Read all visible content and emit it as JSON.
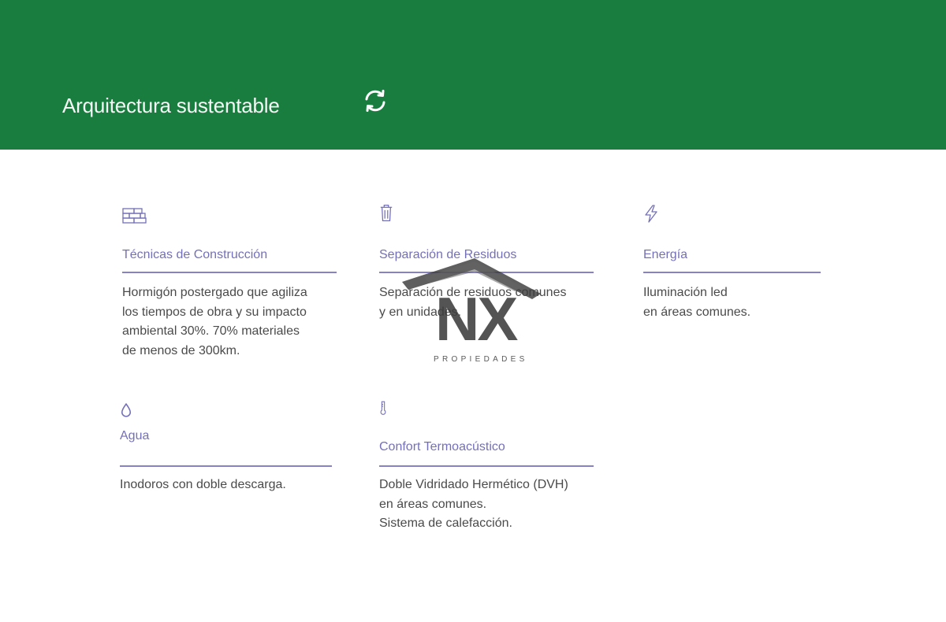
{
  "header": {
    "title": "Arquitectura sustentable",
    "background": "#1a7d40",
    "refresh_icon": "refresh-icon"
  },
  "accent_color": "#7470b8",
  "features": [
    {
      "icon": "bricks-icon",
      "title": "Técnicas de Construcción",
      "lines": [
        "Hormigón postergado que agiliza",
        "los tiempos de obra y su impacto",
        "ambiental 30%. 70% materiales",
        "de menos de 300km."
      ]
    },
    {
      "icon": "trash-icon",
      "title": "Separación de Residuos",
      "lines": [
        "Separación de residuos comunes",
        "y en unidades."
      ]
    },
    {
      "icon": "lightning-icon",
      "title": "Energía",
      "lines": [
        "Iluminación led",
        "en áreas comunes."
      ]
    },
    {
      "icon": "water-drop-icon",
      "title": "Agua",
      "lines": [
        "Inodoros con doble descarga."
      ]
    },
    {
      "icon": "thermometer-icon",
      "title": "Confort Termoacústico",
      "lines": [
        "Doble Vidridado Hermético (DVH)",
        "en áreas comunes.",
        "Sistema de calefacción."
      ]
    }
  ],
  "watermark": {
    "letters": "NX",
    "subtitle": "PROPIEDADES"
  }
}
